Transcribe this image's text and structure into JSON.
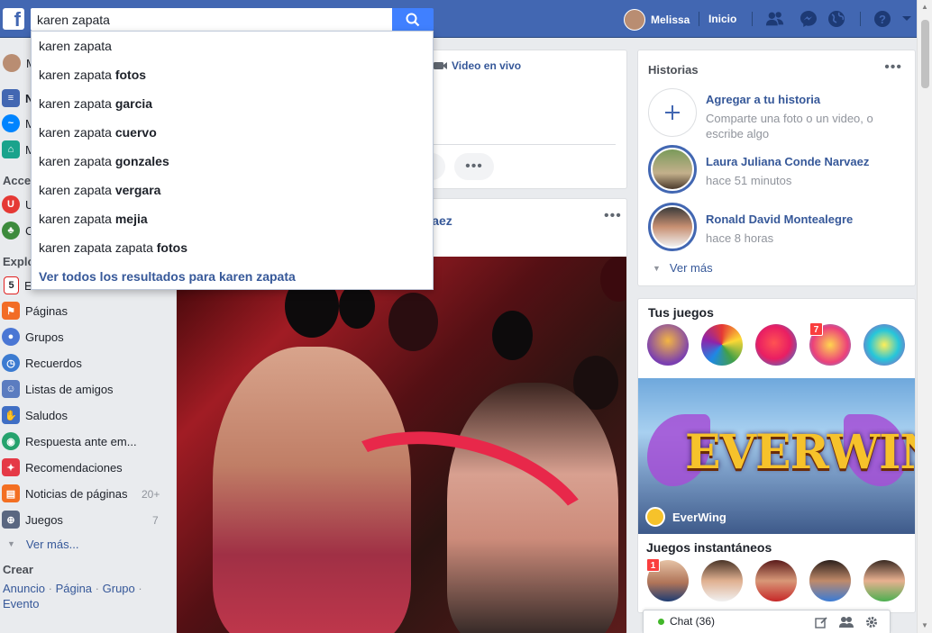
{
  "topbar": {
    "logo": "f",
    "search_value": "karen zapata",
    "user_name": "Melissa",
    "home_label": "Inicio",
    "icons": [
      "friends-icon",
      "messenger-icon",
      "globe-icon",
      "help-icon",
      "caret-down-icon"
    ]
  },
  "suggestions": [
    {
      "prefix": "karen zapata",
      "bold": ""
    },
    {
      "prefix": "karen zapata ",
      "bold": "fotos"
    },
    {
      "prefix": "karen zapata ",
      "bold": "garcia"
    },
    {
      "prefix": "karen zapata ",
      "bold": "cuervo"
    },
    {
      "prefix": "karen zapata ",
      "bold": "gonzales"
    },
    {
      "prefix": "karen zapata ",
      "bold": "vergara"
    },
    {
      "prefix": "karen zapata ",
      "bold": "mejia"
    },
    {
      "prefix": "karen zapata zapata ",
      "bold": "fotos"
    }
  ],
  "see_all_results": "Ver todos los resultados para karen zapata",
  "leftnav": {
    "partial_items": [
      "M",
      "N",
      "M",
      "M"
    ],
    "shortcuts_heading": "Acce",
    "shortcut_partials": [
      "U",
      "C"
    ],
    "explore_heading": "Explo",
    "explore_partial": "E",
    "items": [
      {
        "label": "Páginas",
        "count": ""
      },
      {
        "label": "Grupos",
        "count": ""
      },
      {
        "label": "Recuerdos",
        "count": ""
      },
      {
        "label": "Listas de amigos",
        "count": ""
      },
      {
        "label": "Saludos",
        "count": ""
      },
      {
        "label": "Respuesta ante em...",
        "count": ""
      },
      {
        "label": "Recomendaciones",
        "count": ""
      },
      {
        "label": "Noticias de páginas",
        "count": "20+"
      },
      {
        "label": "Juegos",
        "count": "7"
      }
    ],
    "see_more": "Ver más...",
    "create_heading": "Crear",
    "create_links": [
      "Anuncio",
      "Página",
      "Grupo",
      "Evento"
    ]
  },
  "composer": {
    "live_label": "Video en vivo",
    "more": "•••"
  },
  "post": {
    "author_partial": "rvaez",
    "more": "•••"
  },
  "stories": {
    "title": "Historias",
    "more": "•••",
    "add_title": "Agregar a tu historia",
    "add_sub": "Comparte una foto o un video, o escribe algo",
    "items": [
      {
        "name": "Laura Juliana Conde Narvaez",
        "time": "hace 51 minutos"
      },
      {
        "name": "Ronald David Montealegre",
        "time": "hace 8 horas"
      }
    ],
    "see_more": "Ver más"
  },
  "games": {
    "title": "Tus juegos",
    "badge": "7",
    "banner_title": "EVERWING",
    "banner_name": "EverWing",
    "instant_title": "Juegos instantáneos",
    "instant_badge": "1"
  },
  "chat": {
    "label": "Chat (36)"
  },
  "colors": {
    "brand": "#4267b2",
    "link": "#365899",
    "online": "#42b72a",
    "badge": "#fa3e3e"
  }
}
